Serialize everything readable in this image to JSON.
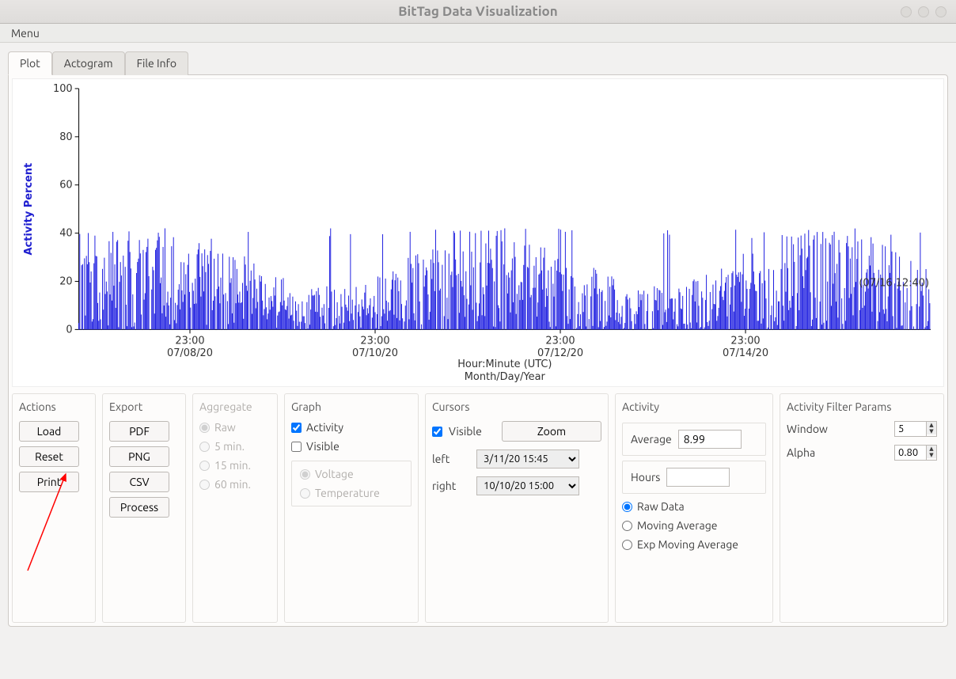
{
  "window": {
    "title": "BitTag Data Visualization"
  },
  "menubar": {
    "menu": "Menu"
  },
  "tabs": [
    {
      "label": "Plot",
      "active": true
    },
    {
      "label": "Actogram",
      "active": false
    },
    {
      "label": "File Info",
      "active": false
    }
  ],
  "chart_data": {
    "type": "bar",
    "title": "",
    "ylabel": "Activity Percent",
    "xlabel_line1": "Hour:Minute (UTC)",
    "xlabel_line2": "Month/Day/Year",
    "ylim": [
      0,
      100
    ],
    "yticks": [
      0,
      20,
      40,
      60,
      80,
      100
    ],
    "xticks": [
      {
        "time": "23:00",
        "date": "07/08/20"
      },
      {
        "time": "23:00",
        "date": "07/10/20"
      },
      {
        "time": "23:00",
        "date": "07/12/20"
      },
      {
        "time": "23:00",
        "date": "07/14/20"
      }
    ],
    "cursor_annotation": "(07/16 12:40)",
    "series_summary": "Dense vertical blue bars representing activity percent over time, values mostly ranging between 0 and ~40 with typical peaks near 35-42 and frequent drops to near 0.",
    "approx_max_value": 42,
    "approx_typical_peak": 36,
    "color": "#2020e0"
  },
  "panels": {
    "actions": {
      "title": "Actions",
      "load": "Load",
      "reset": "Reset",
      "print": "Print"
    },
    "export": {
      "title": "Export",
      "pdf": "PDF",
      "png": "PNG",
      "csv": "CSV",
      "process": "Process"
    },
    "aggregate": {
      "title": "Aggregate",
      "raw": "Raw",
      "five": "5 min.",
      "fifteen": "15 min.",
      "sixty": "60 min."
    },
    "graph": {
      "title": "Graph",
      "activity": "Activity",
      "activity_checked": true,
      "visible": "Visible",
      "visible_checked": false,
      "voltage": "Voltage",
      "temperature": "Temperature"
    },
    "cursors": {
      "title": "Cursors",
      "visible": "Visible",
      "visible_checked": true,
      "zoom": "Zoom",
      "left_label": "left",
      "left_value": "3/11/20 15:45",
      "right_label": "right",
      "right_value": "10/10/20 15:00"
    },
    "activity": {
      "title": "Activity",
      "average_label": "Average",
      "average_value": "8.99",
      "hours_label": "Hours",
      "hours_value": "",
      "raw": "Raw Data",
      "moving": "Moving Average",
      "exp": "Exp Moving Average",
      "selected": "raw"
    },
    "filter": {
      "title": "Activity Filter Params",
      "window_label": "Window",
      "window_value": "5",
      "alpha_label": "Alpha",
      "alpha_value": "0.80"
    }
  }
}
